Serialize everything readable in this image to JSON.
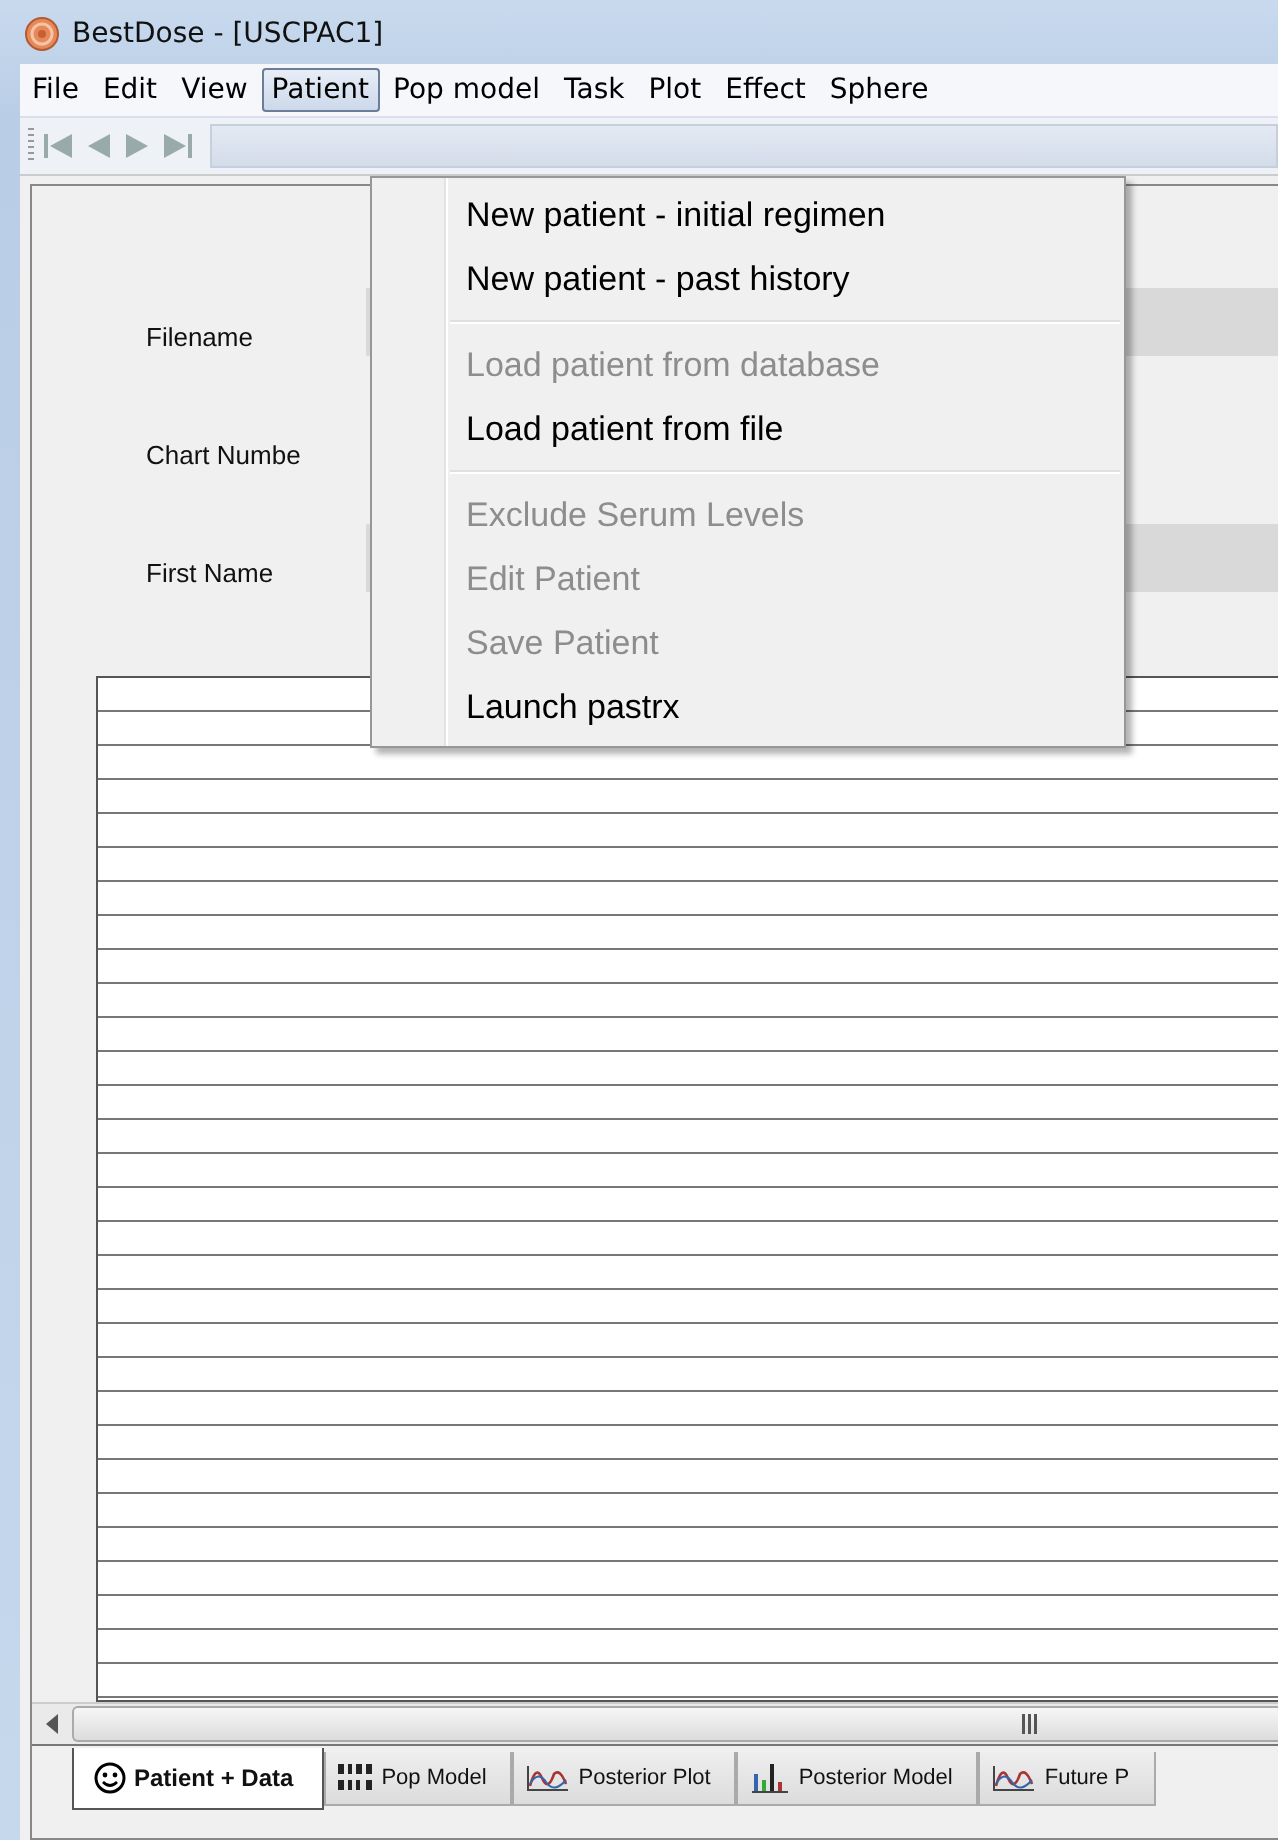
{
  "window": {
    "title": "BestDose - [USCPAC1]"
  },
  "menubar": [
    {
      "label": "File",
      "selected": false
    },
    {
      "label": "Edit",
      "selected": false
    },
    {
      "label": "View",
      "selected": false
    },
    {
      "label": "Patient",
      "selected": true
    },
    {
      "label": "Pop model",
      "selected": false
    },
    {
      "label": "Task",
      "selected": false
    },
    {
      "label": "Plot",
      "selected": false
    },
    {
      "label": "Effect",
      "selected": false
    },
    {
      "label": "Sphere",
      "selected": false
    }
  ],
  "patient_menu": [
    {
      "label": "New patient - initial regimen",
      "disabled": false,
      "separator_after": false
    },
    {
      "label": "New patient - past history",
      "disabled": false,
      "separator_after": true
    },
    {
      "label": "Load patient from database",
      "disabled": true,
      "separator_after": false
    },
    {
      "label": "Load patient from file",
      "disabled": false,
      "separator_after": true
    },
    {
      "label": "Exclude Serum Levels",
      "disabled": true,
      "separator_after": false
    },
    {
      "label": "Edit Patient",
      "disabled": true,
      "separator_after": false
    },
    {
      "label": "Save Patient",
      "disabled": true,
      "separator_after": false
    },
    {
      "label": "Launch pastrx",
      "disabled": false,
      "separator_after": false
    }
  ],
  "form": [
    {
      "label": "Filename"
    },
    {
      "label": "Chart Numbe"
    },
    {
      "label": "First Name"
    }
  ],
  "tabs": [
    {
      "label": "Patient + Data",
      "kind": "face",
      "selected": true
    },
    {
      "label": "Pop Model",
      "kind": "binary",
      "selected": false
    },
    {
      "label": "Posterior Plot",
      "kind": "curve",
      "selected": false
    },
    {
      "label": "Posterior Model",
      "kind": "bars",
      "selected": false
    },
    {
      "label": "Future P",
      "kind": "curve",
      "selected": false
    }
  ]
}
